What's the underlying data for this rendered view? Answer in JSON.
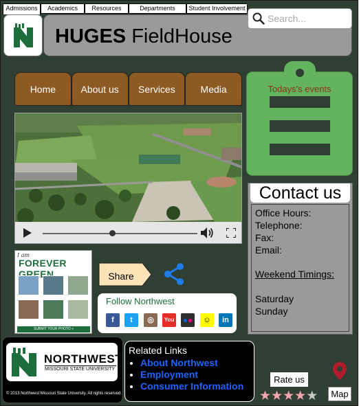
{
  "topnav": {
    "tabs": [
      {
        "label": "Admissions",
        "active": true
      },
      {
        "label": "Academics",
        "active": false
      },
      {
        "label": "Resources",
        "active": false
      },
      {
        "label": "Departments",
        "active": false
      },
      {
        "label": "Student Involvement",
        "active": false
      }
    ]
  },
  "search": {
    "placeholder": "Search..."
  },
  "header": {
    "title_bold": "HUGES",
    "title_rest": "FieldHouse"
  },
  "menu": {
    "items": [
      "Home",
      "About us",
      "Services",
      "Media"
    ]
  },
  "events": {
    "title": "Todays's events"
  },
  "video": {
    "progress": 0.45
  },
  "contact": {
    "title": "Contact us",
    "office_hours": "Office Hours:",
    "telephone": "Telephone:",
    "fax": "Fax:",
    "email": "Email:",
    "weekend_timings": "Weekend Timings:",
    "saturday": "Saturday",
    "sunday": "Sunday"
  },
  "forever_green": {
    "i_am": "I am",
    "title": "FOREVER GREEN",
    "submit": "SUBMIT YOUR PHOTO »"
  },
  "share": {
    "label": "Share"
  },
  "follow": {
    "title": "Follow Northwest",
    "icons": [
      "facebook-icon",
      "twitter-icon",
      "instagram-icon",
      "youtube-icon",
      "flickr-icon",
      "snapchat-icon",
      "linkedin-icon"
    ]
  },
  "footer": {
    "brand": "NORTHWEST",
    "brand_sub": "MISSOURI STATE UNIVERSITY",
    "copyright": "© 2013 Northwest Missouri State University. All rights reserved.",
    "related_title": "Related Links",
    "related_links": [
      "About Northwest",
      "Employment",
      "Consumer Information"
    ],
    "rate_label": "Rate us",
    "rating": 4,
    "rating_max": 5,
    "map_label": "Map"
  },
  "colors": {
    "page_bg": "#2f3f33",
    "menu_brown": "#8c5a22",
    "events_green": "#64b35e",
    "brand_green": "#1d6e3c",
    "link_blue": "#1e62ff",
    "star_pink": "#f4a7b0"
  }
}
